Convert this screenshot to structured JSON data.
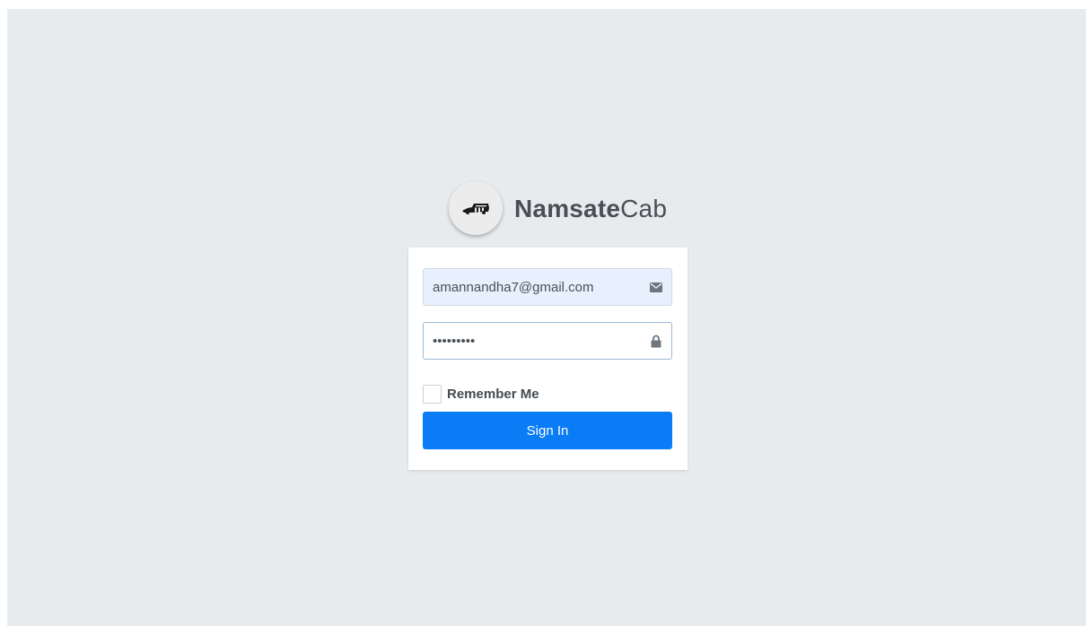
{
  "brand": {
    "name_bold": "Namsate",
    "name_light": "Cab",
    "logo_icon": "car-logo-icon"
  },
  "login": {
    "email_value": "amannandha7@gmail.com",
    "email_icon": "envelope-icon",
    "password_value": "•••••••••",
    "password_icon": "lock-icon",
    "remember_label": "Remember Me",
    "remember_checked": false,
    "signin_label": "Sign In"
  },
  "colors": {
    "background": "#e8ebee",
    "primary": "#0a7cf6",
    "autofill": "#e8f0fe"
  }
}
